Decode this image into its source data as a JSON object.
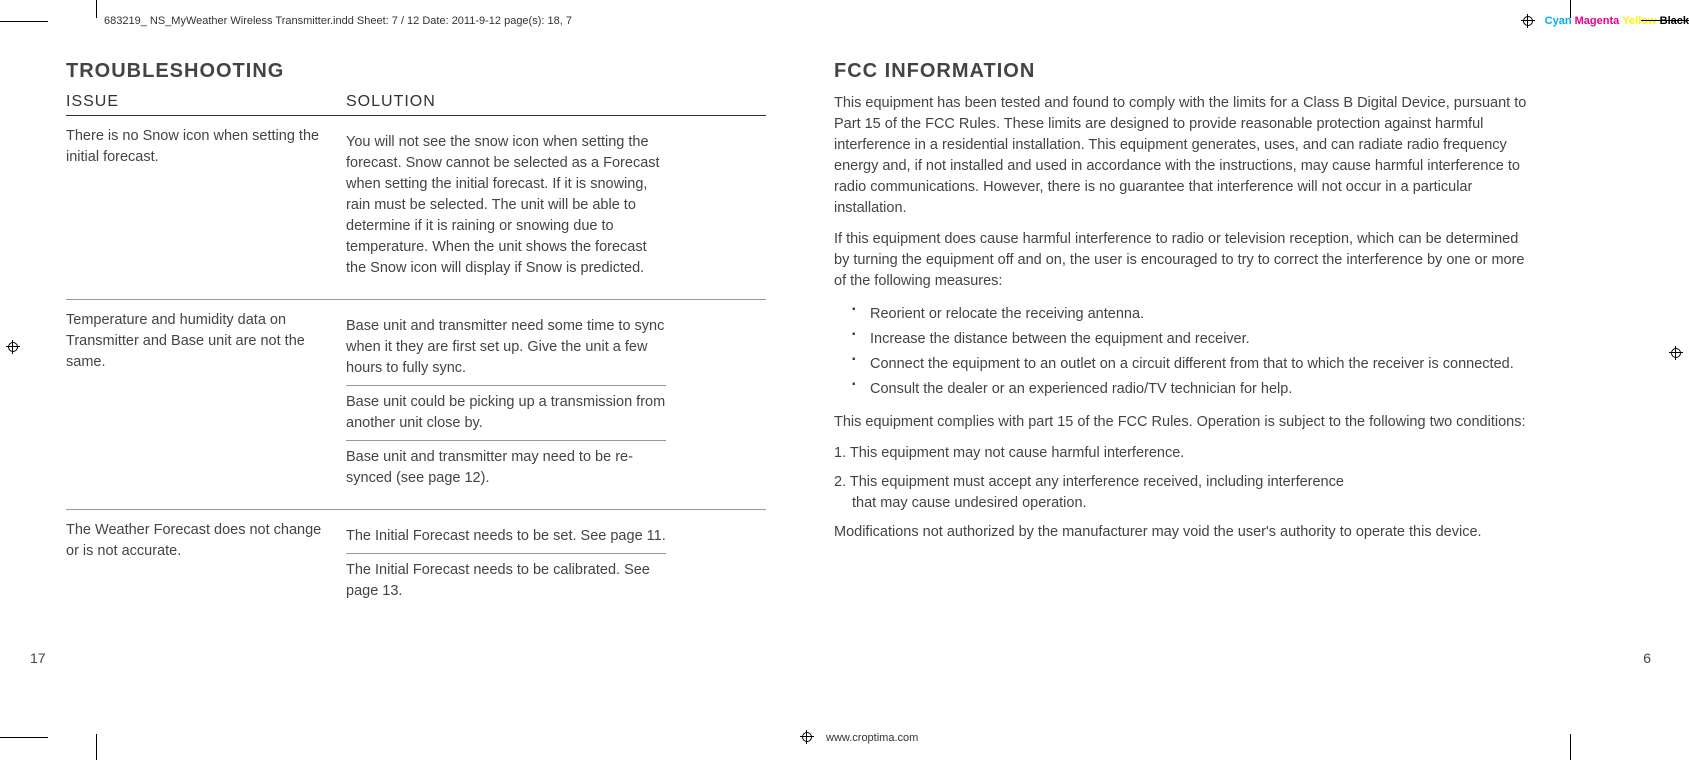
{
  "header": {
    "filename": "683219_ NS_MyWeather Wireless Transmitter.indd   Sheet: 7 / 12   Date: 2011-9-12   page(s): 18, 7",
    "colors": {
      "cyan": "Cyan",
      "magenta": "Magenta",
      "yellow": "Yellow",
      "black": "Black"
    }
  },
  "footer": {
    "url": "www.croptima.com"
  },
  "left": {
    "title": "TROUBLESHOOTING",
    "head_issue": "ISSUE",
    "head_solution": "SOLUTION",
    "rows": [
      {
        "issue": "There is no Snow icon when setting the initial forecast.",
        "solutions": [
          "You will not see the snow icon when setting the forecast. Snow cannot be selected as a Forecast when setting the initial forecast. If it is snowing, rain must be selected. The unit will be able to determine if it is raining or snowing due to temperature. When the unit shows the forecast the Snow icon will display if Snow is predicted."
        ]
      },
      {
        "issue": "Temperature and humidity data on Transmitter and Base unit are not the same.",
        "solutions": [
          "Base unit and transmitter need some time to sync when it they are first set up. Give the unit a few hours to fully sync.",
          "Base unit could be picking up a transmission from another unit close by.",
          "Base unit and transmitter may need to be re-synced (see page 12)."
        ]
      },
      {
        "issue": "The Weather Forecast does not change or is not accurate.",
        "solutions": [
          "The Initial Forecast needs to be set. See page 11.",
          "The Initial Forecast needs to be calibrated. See page 13."
        ]
      }
    ],
    "page_no": "17"
  },
  "right": {
    "title": "FCC INFORMATION",
    "p1": "This equipment has been tested and found to comply with the limits for a Class B Digital Device, pursuant to Part 15 of the FCC Rules. These limits are designed to provide reasonable protection against harmful interference in a residential installation. This equipment generates, uses, and can radiate radio frequency energy and, if not installed and used in accordance with the instructions, may cause harmful interference to radio communications. However, there is no guarantee that interference will not occur in a particular installation.",
    "p2": "If this equipment does cause harmful interference to radio or television reception, which can be determined by turning the equipment off and on, the user is encouraged to try to correct the interference by one or more of the following measures:",
    "bullets": [
      "Reorient or relocate the receiving antenna.",
      "Increase the distance between the equipment and receiver.",
      "Connect the equipment to an outlet on a circuit different from that to which the receiver is connected.",
      "Consult the dealer or an experienced radio/TV technician for help."
    ],
    "p3": "This equipment complies with part 15 of the FCC Rules. Operation is subject to the following two conditions:",
    "n1": "1. This equipment may not cause harmful interference.",
    "n2a": "2. This equipment must accept any interference received, including interference",
    "n2b": "that may cause undesired operation.",
    "p4": "Modifications not authorized by the manufacturer may void the user's authority to operate this device.",
    "page_no": "6"
  }
}
